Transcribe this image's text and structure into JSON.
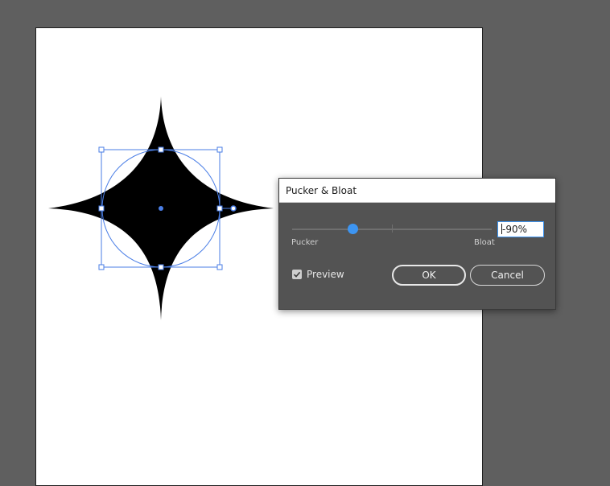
{
  "dialog": {
    "title": "Pucker & Bloat",
    "slider": {
      "value_text": "-90%",
      "value_percent": -90,
      "min": -100,
      "max": 100,
      "min_label": "Pucker",
      "max_label": "Bloat"
    },
    "preview_label": "Preview",
    "preview_checked": true,
    "ok_label": "OK",
    "cancel_label": "Cancel"
  },
  "colors": {
    "workspace": "#5f5f5f",
    "selection": "#4a7ee6",
    "accent": "#3d95f2",
    "shape_fill": "#000000"
  }
}
